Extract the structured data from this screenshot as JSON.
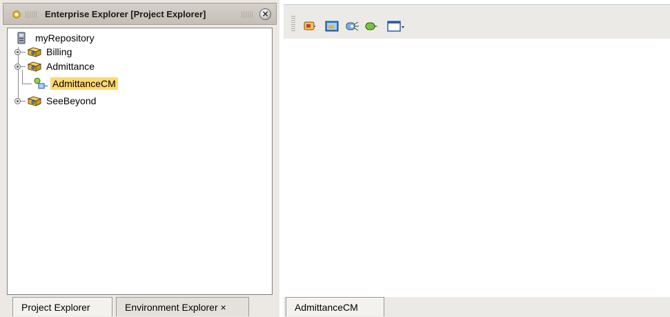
{
  "explorer": {
    "title": "Enterprise Explorer [Project Explorer]",
    "close_label": "×",
    "tree": [
      {
        "label": "myRepository",
        "icon": "repository-icon"
      },
      {
        "label": "Billing",
        "icon": "project-icon"
      },
      {
        "label": "Admittance",
        "icon": "project-icon"
      },
      {
        "label": "AdmittanceCM",
        "icon": "connectivity-map-icon",
        "selected": true
      },
      {
        "label": "SeeBeyond",
        "icon": "project-icon"
      }
    ],
    "tabs": [
      {
        "label": "Project Explorer",
        "active": true
      },
      {
        "label": "Environment Explorer ×",
        "active": false
      }
    ]
  },
  "editor": {
    "toolbar": [
      "add-service-icon",
      "add-external-application-icon",
      "add-web-service-icon",
      "add-collaboration-icon",
      "window-dropdown-icon"
    ],
    "tabs": [
      {
        "label": "AdmittanceCM"
      }
    ]
  },
  "colors": {
    "selection": "#ffd773",
    "toolbar_bg": "#eceae6",
    "panel_bg": "#ece9e4"
  }
}
